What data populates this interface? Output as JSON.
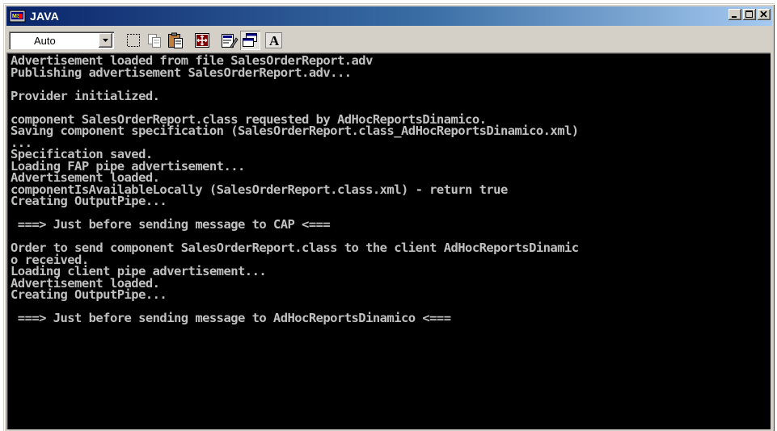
{
  "window": {
    "title": "JAVA",
    "icon": "ms-dos-icon",
    "caption_buttons": [
      "minimize",
      "maximize",
      "close"
    ]
  },
  "toolbar": {
    "font_size_value": "Auto",
    "buttons": [
      {
        "name": "mark-button",
        "icon": "mark-icon"
      },
      {
        "name": "copy-button",
        "icon": "copy-icon"
      },
      {
        "name": "paste-button",
        "icon": "paste-icon"
      },
      {
        "name": "full-screen-button",
        "icon": "full-screen-icon"
      },
      {
        "name": "properties-button",
        "icon": "properties-icon"
      },
      {
        "name": "background-button",
        "icon": "background-icon"
      },
      {
        "name": "font-button",
        "icon": "font-icon",
        "label": "A"
      }
    ]
  },
  "console": {
    "lines": [
      "Advertisement loaded from file SalesOrderReport.adv",
      "Publishing advertisement SalesOrderReport.adv...",
      "",
      "Provider initialized.",
      "",
      "component SalesOrderReport.class requested by AdHocReportsDinamico.",
      "Saving component specification (SalesOrderReport.class_AdHocReportsDinamico.xml)",
      "...",
      "Specification saved.",
      "Loading FAP pipe advertisement...",
      "Advertisement loaded.",
      "componentIsAvailableLocally (SalesOrderReport.class.xml) - return true",
      "Creating OutputPipe...",
      "",
      " ===> Just before sending message to CAP <===",
      "",
      "Order to send component SalesOrderReport.class to the client AdHocReportsDinamic",
      "o received.",
      "Loading client pipe advertisement...",
      "Advertisement loaded.",
      "Creating OutputPipe...",
      "",
      " ===> Just before sending message to AdHocReportsDinamico <==="
    ]
  },
  "colors": {
    "titlebar_start": "#0a246a",
    "titlebar_end": "#a6caf0",
    "console_bg": "#000000",
    "console_text": "#c0c0c0",
    "chrome": "#d4d0c8"
  }
}
